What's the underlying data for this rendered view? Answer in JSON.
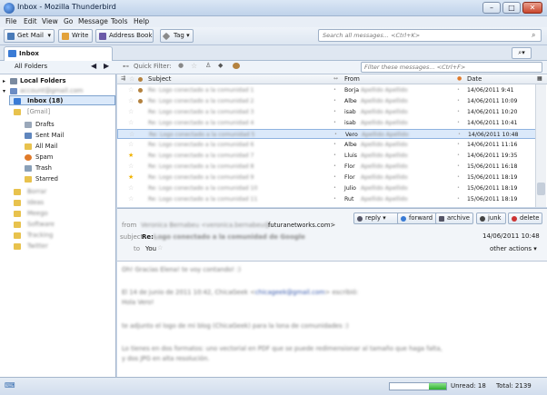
{
  "window": {
    "title": "Inbox - Mozilla Thunderbird",
    "min_label": "–",
    "max_label": "□",
    "close_label": "✕"
  },
  "menu": [
    "File",
    "Edit",
    "View",
    "Go",
    "Message",
    "Tools",
    "Help"
  ],
  "toolbar": {
    "get_mail": "Get Mail",
    "write": "Write",
    "address_book": "Address Book",
    "tag": "Tag",
    "search_placeholder": "Search all messages... <Ctrl+K>"
  },
  "tab": {
    "label": "Inbox"
  },
  "filter": {
    "label": "Quick Filter:",
    "placeholder": "Filter these messages... <Ctrl+F>"
  },
  "folders": {
    "header": "All Folders",
    "local": "Local Folders",
    "inbox": "Inbox (18)",
    "account": "[Gmail]",
    "gmail_items": [
      "Drafts",
      "Sent Mail",
      "All Mail",
      "Spam",
      "Trash",
      "Starred"
    ]
  },
  "columns": {
    "subject": "Subject",
    "from": "From",
    "date": "Date"
  },
  "messages": [
    {
      "starred": false,
      "attach": true,
      "from": "Borja",
      "date": "14/06/2011 9:41"
    },
    {
      "starred": false,
      "attach": true,
      "from": "Albe",
      "date": "14/06/2011 10:09"
    },
    {
      "starred": false,
      "attach": false,
      "from": "isab",
      "date": "14/06/2011 10:20"
    },
    {
      "starred": false,
      "attach": false,
      "from": "isab",
      "date": "14/06/2011 10:41"
    },
    {
      "starred": false,
      "attach": false,
      "from": "Vero",
      "date": "14/06/2011 10:48",
      "selected": true
    },
    {
      "starred": false,
      "attach": false,
      "from": "Albe",
      "date": "14/06/2011 11:16"
    },
    {
      "starred": true,
      "attach": false,
      "from": "Lluis",
      "date": "14/06/2011 19:35"
    },
    {
      "starred": false,
      "attach": false,
      "from": "Flor",
      "date": "15/06/2011 16:18"
    },
    {
      "starred": true,
      "attach": false,
      "from": "Flor",
      "date": "15/06/2011 18:19"
    },
    {
      "starred": false,
      "attach": false,
      "from": "Julio",
      "date": "15/06/2011 18:19"
    },
    {
      "starred": false,
      "attach": false,
      "from": "Rut",
      "date": "15/06/2011 18:19"
    }
  ],
  "header": {
    "from_label": "from",
    "from_suffix": "futuranetworks.com>",
    "subject_label": "subject",
    "subject_prefix": "Re:",
    "to_label": "to",
    "to_value": "You",
    "date": "14/06/2011 10:48",
    "reply": "reply",
    "forward": "forward",
    "archive": "archive",
    "junk": "junk",
    "delete": "delete",
    "other_actions": "other actions"
  },
  "status": {
    "unread": "Unread: 18",
    "total": "Total: 2139"
  },
  "colors": {
    "selection": "#dbe9fa",
    "star": "#f1b300",
    "accent": "#3a7bd5"
  }
}
